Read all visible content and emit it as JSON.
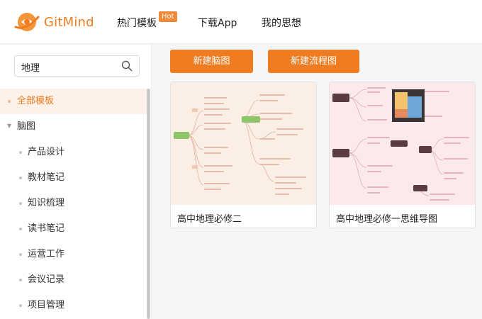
{
  "brand": {
    "name": "GitMind"
  },
  "nav": {
    "templates": "热门模板",
    "hot_badge": "Hot",
    "download": "下载App",
    "my_thoughts": "我的思想"
  },
  "search": {
    "value": "地理"
  },
  "sidebar": {
    "items": [
      {
        "label": "全部模板"
      },
      {
        "label": "脑图"
      },
      {
        "label": "产品设计"
      },
      {
        "label": "教材笔记"
      },
      {
        "label": "知识梳理"
      },
      {
        "label": "读书笔记"
      },
      {
        "label": "运营工作"
      },
      {
        "label": "会议记录"
      },
      {
        "label": "项目管理"
      }
    ]
  },
  "actions": {
    "new_mindmap": "新建脑图",
    "new_flowchart": "新建流程图"
  },
  "templates": [
    {
      "title": "高中地理必修二"
    },
    {
      "title": "高中地理必修一思维导图"
    }
  ],
  "colors": {
    "accent": "#f07c21",
    "active_bg": "#fdf1e9",
    "thumb1_bg": "#fbeee4",
    "thumb2_bg": "#fbe9ec",
    "mindmap_green": "#8ec56b"
  }
}
